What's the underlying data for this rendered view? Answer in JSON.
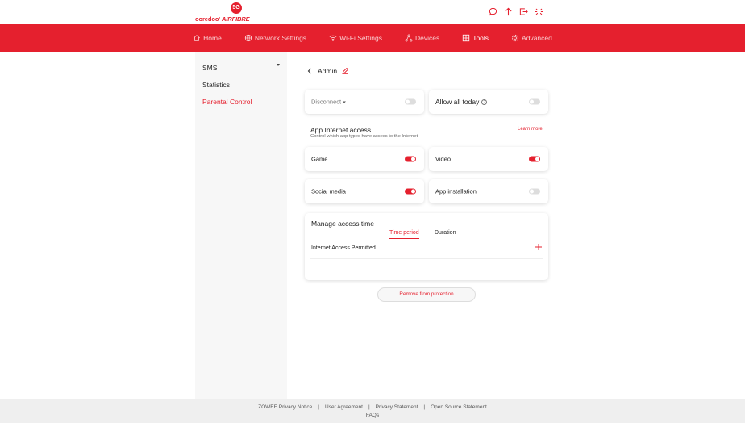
{
  "brand": {
    "badge": "5G",
    "name_part1": "ooredoo'",
    "name_part2": "AIRFIBRE",
    "color": "#e5202e"
  },
  "top_icons": [
    "chat-icon",
    "upload-arrow-icon",
    "logout-icon",
    "loading-spinner-icon"
  ],
  "nav": {
    "items": [
      {
        "label": "Home",
        "icon": "home-icon",
        "active": false
      },
      {
        "label": "Network Settings",
        "icon": "globe-icon",
        "active": false
      },
      {
        "label": "Wi-Fi Settings",
        "icon": "wifi-icon",
        "active": false
      },
      {
        "label": "Devices",
        "icon": "devices-icon",
        "active": false
      },
      {
        "label": "Tools",
        "icon": "tools-icon",
        "active": true
      },
      {
        "label": "Advanced",
        "icon": "gear-icon",
        "active": false
      }
    ]
  },
  "sidebar": {
    "items": [
      {
        "label": "SMS"
      },
      {
        "label": "Statistics"
      },
      {
        "label": "Parental Control"
      }
    ]
  },
  "profile": {
    "name": "Admin"
  },
  "cards": {
    "disconnect": {
      "label": "Disconnect",
      "on": false
    },
    "allow_all_today": {
      "label": "Allow all today",
      "help": "?",
      "on": false
    }
  },
  "app_access": {
    "title": "App Internet access",
    "subtitle": "Control which app types have access to the Internet",
    "learn_more": "Learn more",
    "apps": [
      {
        "label": "Game",
        "on": true
      },
      {
        "label": "Video",
        "on": true
      },
      {
        "label": "Social media",
        "on": true
      },
      {
        "label": "App installation",
        "on": false
      }
    ]
  },
  "access_time": {
    "title": "Manage access time",
    "tabs": [
      {
        "label": "Time period",
        "active": true
      },
      {
        "label": "Duration",
        "active": false
      }
    ],
    "row_label": "Internet Access Permitted"
  },
  "remove_button": "Remove from protection",
  "footer": {
    "links": [
      "ZOWEE Privacy Notice",
      "User Agreement",
      "Privacy Statement",
      "Open Source Statement"
    ],
    "separator": "|",
    "faq": "FAQs"
  }
}
